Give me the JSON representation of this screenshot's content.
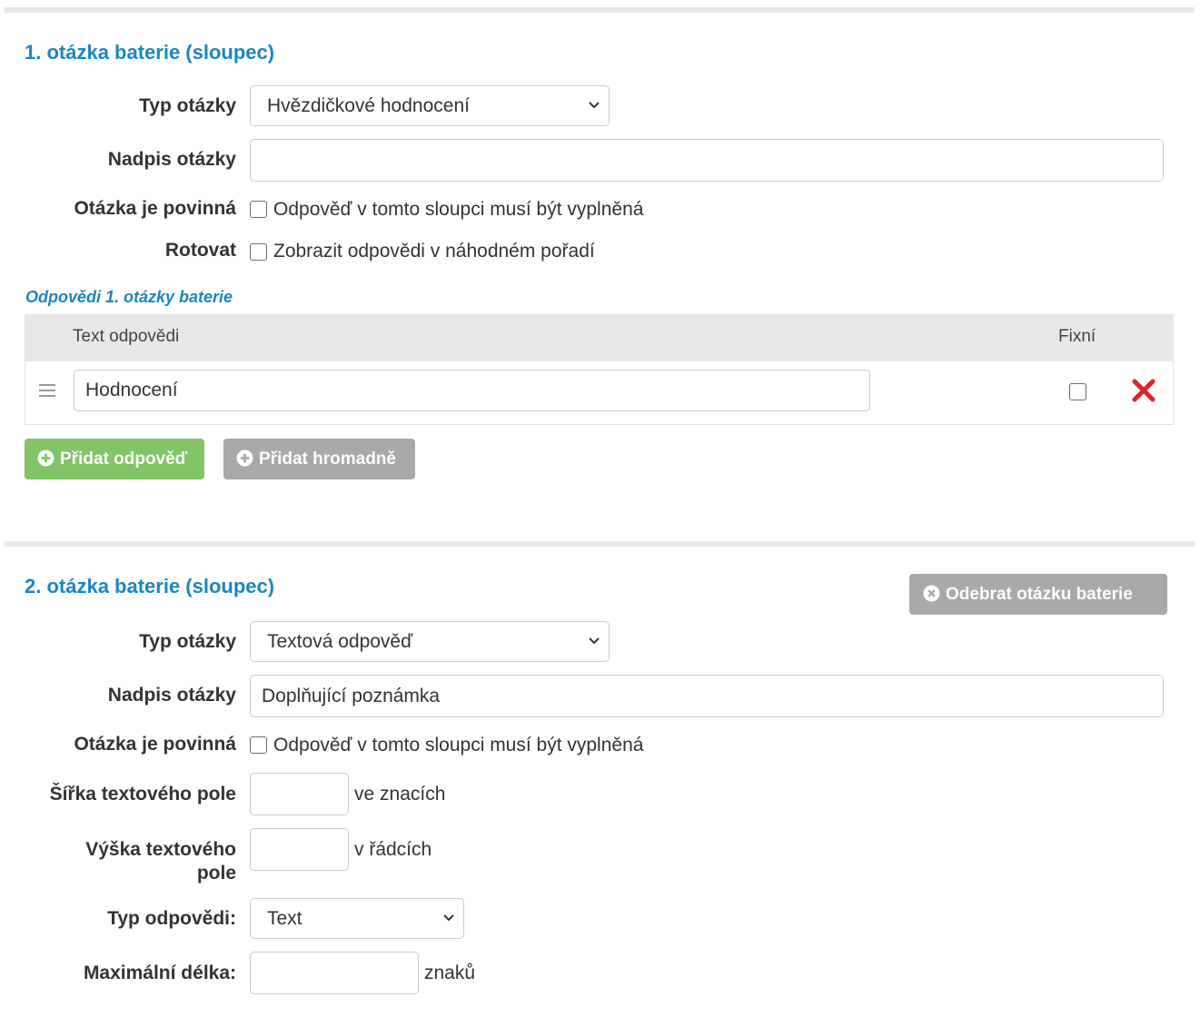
{
  "q1": {
    "title": "1. otázka baterie (sloupec)",
    "type_label": "Typ otázky",
    "type_value": "Hvězdičkové hodnocení",
    "heading_label": "Nadpis otázky",
    "heading_value": "",
    "required_label": "Otázka je povinná",
    "required_text": "Odpověď v tomto sloupci musí být vyplněná",
    "required_checked": false,
    "rotate_label": "Rotovat",
    "rotate_text": "Zobrazit odpovědi v náhodném pořadí",
    "rotate_checked": false,
    "answers_heading": "Odpovědi 1. otázky baterie",
    "answers_table": {
      "col_text": "Text odpovědi",
      "col_fixed": "Fixní",
      "rows": [
        {
          "text": "Hodnocení",
          "fixed": false
        }
      ]
    },
    "add_answer_label": "Přidat odpověď",
    "add_bulk_label": "Přidat hromadně"
  },
  "q2": {
    "title": "2. otázka baterie (sloupec)",
    "remove_label": "Odebrat otázku baterie",
    "type_label": "Typ otázky",
    "type_value": "Textová odpověď",
    "heading_label": "Nadpis otázky",
    "heading_value": "Doplňující poznámka",
    "required_label": "Otázka je povinná",
    "required_text": "Odpověď v tomto sloupci musí být vyplněná",
    "required_checked": false,
    "width_label": "Šířka textového pole",
    "width_value": "",
    "width_unit": "ve znacích",
    "height_label_1": "Výška textového",
    "height_label_2": "pole",
    "height_value": "",
    "height_unit": "v řádcích",
    "answer_type_label": "Typ odpovědi:",
    "answer_type_value": "Text",
    "maxlen_label": "Maximální délka:",
    "maxlen_value": "",
    "maxlen_unit": "znaků"
  },
  "colors": {
    "accent": "#1b87c0",
    "add_button": "#82c466",
    "secondary_button": "#a9a9a9",
    "delete_icon": "#d9272e",
    "divider": "#e8e8e8",
    "table_header": "#e8e8e8"
  },
  "icons": {
    "select_arrow": "chevron-down-icon",
    "drag_handle": "drag-handle-icon",
    "delete": "close-icon",
    "add": "plus-circle-icon",
    "remove": "x-circle-icon"
  }
}
